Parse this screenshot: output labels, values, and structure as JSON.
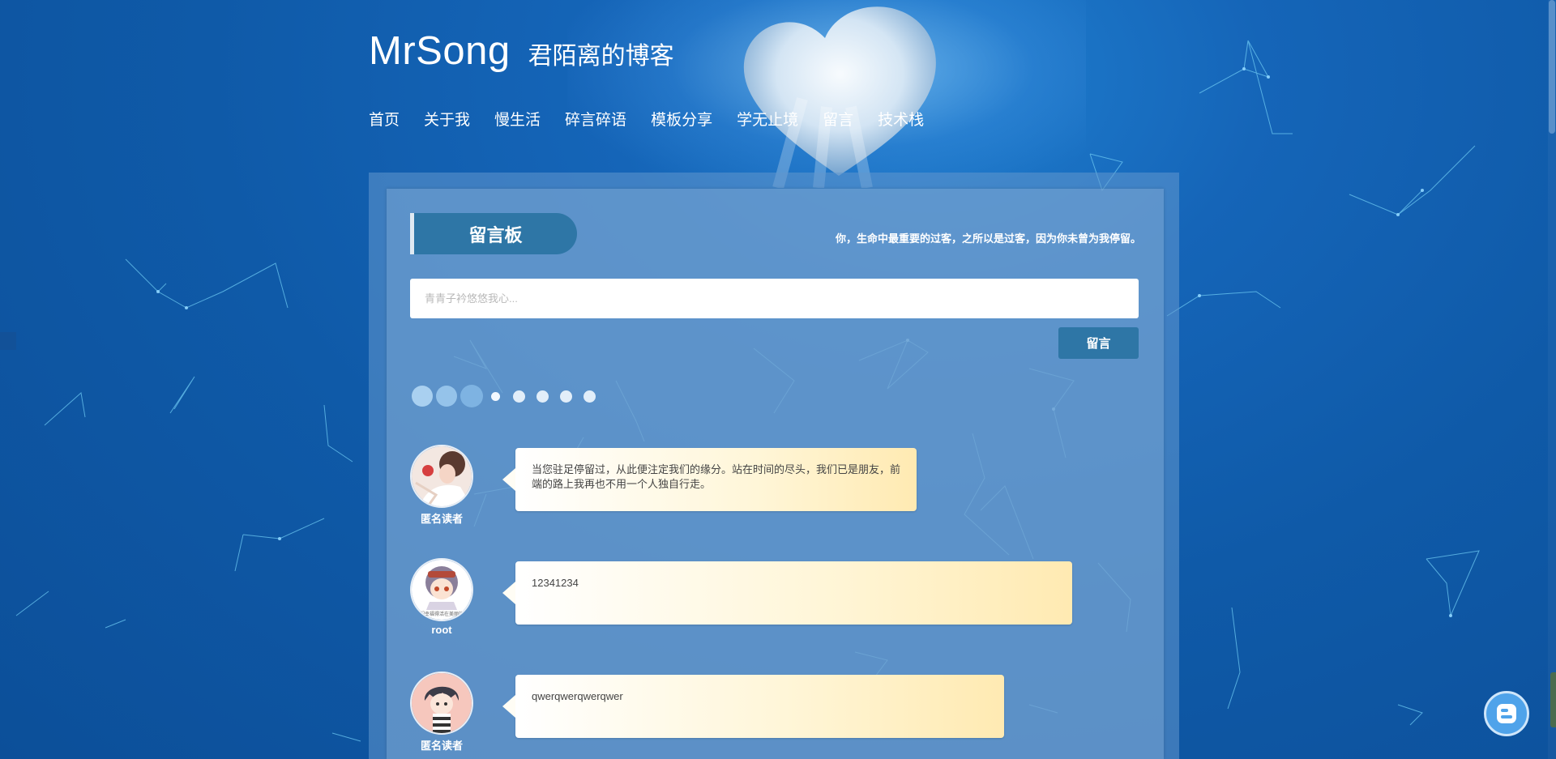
{
  "site": {
    "name": "MrSong",
    "subtitle": "君陌离的博客"
  },
  "nav": {
    "items": [
      "首页",
      "关于我",
      "慢生活",
      "碎言碎语",
      "模板分享",
      "学无止境",
      "留言",
      "技术栈"
    ]
  },
  "board": {
    "title": "留言板",
    "motto": "你，生命中最重要的过客，之所以是过客，因为你未曾为我停留。",
    "input_placeholder": "青青子衿悠悠我心...",
    "input_value": "",
    "submit_label": "留言"
  },
  "comments": [
    {
      "author": "匿名读者",
      "text": "当您驻足停留过，从此便注定我们的缘分。站在时间的尽头，我们已是朋友，前端的路上我再也不用一个人独自行走。"
    },
    {
      "author": "root",
      "text": "12341234",
      "avatar_caption": "让我们幸福得活在美丽的人世"
    },
    {
      "author": "匿名读者",
      "text": "qwerqwerqwerqwer"
    }
  ],
  "colors": {
    "accent": "#2e76a6",
    "background": "#0f5aa8",
    "bubble_end": "#ffeab2"
  }
}
